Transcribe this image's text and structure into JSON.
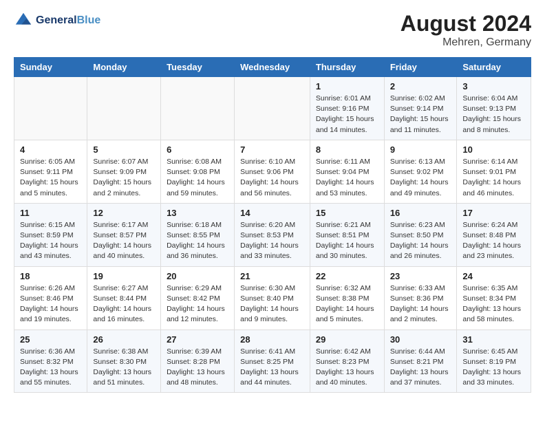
{
  "header": {
    "logo_line1": "General",
    "logo_line2": "Blue",
    "main_title": "August 2024",
    "subtitle": "Mehren, Germany"
  },
  "calendar": {
    "days_of_week": [
      "Sunday",
      "Monday",
      "Tuesday",
      "Wednesday",
      "Thursday",
      "Friday",
      "Saturday"
    ],
    "weeks": [
      [
        {
          "day": "",
          "info": ""
        },
        {
          "day": "",
          "info": ""
        },
        {
          "day": "",
          "info": ""
        },
        {
          "day": "",
          "info": ""
        },
        {
          "day": "1",
          "info": "Sunrise: 6:01 AM\nSunset: 9:16 PM\nDaylight: 15 hours\nand 14 minutes."
        },
        {
          "day": "2",
          "info": "Sunrise: 6:02 AM\nSunset: 9:14 PM\nDaylight: 15 hours\nand 11 minutes."
        },
        {
          "day": "3",
          "info": "Sunrise: 6:04 AM\nSunset: 9:13 PM\nDaylight: 15 hours\nand 8 minutes."
        }
      ],
      [
        {
          "day": "4",
          "info": "Sunrise: 6:05 AM\nSunset: 9:11 PM\nDaylight: 15 hours\nand 5 minutes."
        },
        {
          "day": "5",
          "info": "Sunrise: 6:07 AM\nSunset: 9:09 PM\nDaylight: 15 hours\nand 2 minutes."
        },
        {
          "day": "6",
          "info": "Sunrise: 6:08 AM\nSunset: 9:08 PM\nDaylight: 14 hours\nand 59 minutes."
        },
        {
          "day": "7",
          "info": "Sunrise: 6:10 AM\nSunset: 9:06 PM\nDaylight: 14 hours\nand 56 minutes."
        },
        {
          "day": "8",
          "info": "Sunrise: 6:11 AM\nSunset: 9:04 PM\nDaylight: 14 hours\nand 53 minutes."
        },
        {
          "day": "9",
          "info": "Sunrise: 6:13 AM\nSunset: 9:02 PM\nDaylight: 14 hours\nand 49 minutes."
        },
        {
          "day": "10",
          "info": "Sunrise: 6:14 AM\nSunset: 9:01 PM\nDaylight: 14 hours\nand 46 minutes."
        }
      ],
      [
        {
          "day": "11",
          "info": "Sunrise: 6:15 AM\nSunset: 8:59 PM\nDaylight: 14 hours\nand 43 minutes."
        },
        {
          "day": "12",
          "info": "Sunrise: 6:17 AM\nSunset: 8:57 PM\nDaylight: 14 hours\nand 40 minutes."
        },
        {
          "day": "13",
          "info": "Sunrise: 6:18 AM\nSunset: 8:55 PM\nDaylight: 14 hours\nand 36 minutes."
        },
        {
          "day": "14",
          "info": "Sunrise: 6:20 AM\nSunset: 8:53 PM\nDaylight: 14 hours\nand 33 minutes."
        },
        {
          "day": "15",
          "info": "Sunrise: 6:21 AM\nSunset: 8:51 PM\nDaylight: 14 hours\nand 30 minutes."
        },
        {
          "day": "16",
          "info": "Sunrise: 6:23 AM\nSunset: 8:50 PM\nDaylight: 14 hours\nand 26 minutes."
        },
        {
          "day": "17",
          "info": "Sunrise: 6:24 AM\nSunset: 8:48 PM\nDaylight: 14 hours\nand 23 minutes."
        }
      ],
      [
        {
          "day": "18",
          "info": "Sunrise: 6:26 AM\nSunset: 8:46 PM\nDaylight: 14 hours\nand 19 minutes."
        },
        {
          "day": "19",
          "info": "Sunrise: 6:27 AM\nSunset: 8:44 PM\nDaylight: 14 hours\nand 16 minutes."
        },
        {
          "day": "20",
          "info": "Sunrise: 6:29 AM\nSunset: 8:42 PM\nDaylight: 14 hours\nand 12 minutes."
        },
        {
          "day": "21",
          "info": "Sunrise: 6:30 AM\nSunset: 8:40 PM\nDaylight: 14 hours\nand 9 minutes."
        },
        {
          "day": "22",
          "info": "Sunrise: 6:32 AM\nSunset: 8:38 PM\nDaylight: 14 hours\nand 5 minutes."
        },
        {
          "day": "23",
          "info": "Sunrise: 6:33 AM\nSunset: 8:36 PM\nDaylight: 14 hours\nand 2 minutes."
        },
        {
          "day": "24",
          "info": "Sunrise: 6:35 AM\nSunset: 8:34 PM\nDaylight: 13 hours\nand 58 minutes."
        }
      ],
      [
        {
          "day": "25",
          "info": "Sunrise: 6:36 AM\nSunset: 8:32 PM\nDaylight: 13 hours\nand 55 minutes."
        },
        {
          "day": "26",
          "info": "Sunrise: 6:38 AM\nSunset: 8:30 PM\nDaylight: 13 hours\nand 51 minutes."
        },
        {
          "day": "27",
          "info": "Sunrise: 6:39 AM\nSunset: 8:28 PM\nDaylight: 13 hours\nand 48 minutes."
        },
        {
          "day": "28",
          "info": "Sunrise: 6:41 AM\nSunset: 8:25 PM\nDaylight: 13 hours\nand 44 minutes."
        },
        {
          "day": "29",
          "info": "Sunrise: 6:42 AM\nSunset: 8:23 PM\nDaylight: 13 hours\nand 40 minutes."
        },
        {
          "day": "30",
          "info": "Sunrise: 6:44 AM\nSunset: 8:21 PM\nDaylight: 13 hours\nand 37 minutes."
        },
        {
          "day": "31",
          "info": "Sunrise: 6:45 AM\nSunset: 8:19 PM\nDaylight: 13 hours\nand 33 minutes."
        }
      ]
    ]
  }
}
